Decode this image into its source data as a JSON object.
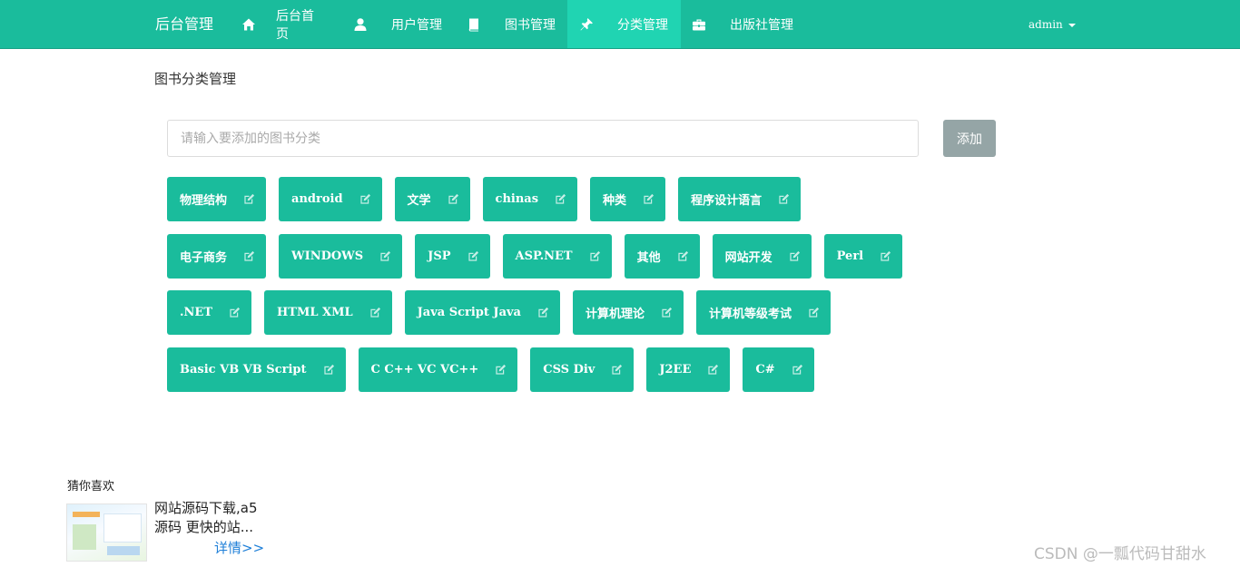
{
  "navbar": {
    "brand": "后台管理",
    "items": [
      {
        "label": "后台首页",
        "icon": "home-icon"
      },
      {
        "label": "用户管理",
        "icon": "user-icon"
      },
      {
        "label": "图书管理",
        "icon": "book-icon"
      },
      {
        "label": "分类管理",
        "icon": "pushpin-icon",
        "active": true
      },
      {
        "label": "出版社管理",
        "icon": "briefcase-icon"
      }
    ],
    "user": "admin"
  },
  "page": {
    "title": "图书分类管理",
    "input_placeholder": "请输入要添加的图书分类",
    "input_value": "",
    "add_button": "添加"
  },
  "categories": [
    [
      "物理结构",
      "android",
      "文学",
      "chinas",
      "种类",
      "程序设计语言"
    ],
    [
      "电子商务",
      "WINDOWS",
      "JSP",
      "ASP.NET",
      "其他",
      "网站开发",
      "Perl"
    ],
    [
      ".NET",
      "HTML XML",
      "Java Script Java",
      "计算机理论",
      "计算机等级考试"
    ],
    [
      "Basic VB VB Script",
      "C C++ VC VC++",
      "CSS Div",
      "J2EE",
      "C#"
    ]
  ],
  "recommend": {
    "title": "猜你喜欢",
    "text": "网站源码下载,a5源码 更快的站...",
    "link": "详情>>"
  },
  "watermark": "CSDN @一瓢代码甘甜水",
  "colors": {
    "primary": "#1abc9c",
    "active_nav": "#20d4b2",
    "add_button": "#95a5a6",
    "link": "#1e7fd8"
  }
}
